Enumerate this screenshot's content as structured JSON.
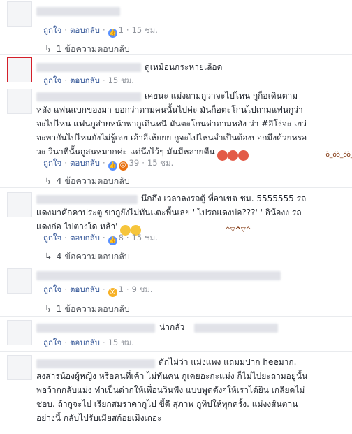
{
  "labels": {
    "like": "ถูกใจ",
    "reply": "ตอบกลับ",
    "dot": "·"
  },
  "comments": [
    {
      "count": "1",
      "time": "15 ชม.",
      "reply_summary": "1 ข้อความตอบกลับ"
    },
    {
      "text": "ดูเหมือนกระหายเลือด",
      "time": "15 ชม."
    },
    {
      "text": "เคยนะ แม่งถามกูว่าจะไปไหน กูก็อเดินตามหลัง แฟนแบกของมา บอกว่าตามคนนั้นไปค่ะ มันก็อตะโกนไปถามแฟนกูว่า จะไปไหน แฟนกูส่ายหน้าพากูเดินหนี มันตะโกนด่าตามหลัง ว่า #อีโง่จะ เยว่จะพากันไปไหนยังไม่รู้เลย เอ้าอีเห้ยยย กูจะไปไหนจำเป็นต้องบอกมึงด้วยหรอวะ วินาทีนั้นกูสนหมากค่ะ แต่นึงไว้ๆ มันมีหลายตีน",
      "count": "39",
      "time": "15 ชม.",
      "reply_summary": "4 ข้อความตอบกลับ"
    },
    {
      "text": "นึกถึง เวลาลงรถตู้ ที่อาเขต ชม. 5555555 รถแดงมาคักคาประตู ขากูยังไม่ทันแตะพื้นเลย ' ไปรถแดงบ่อ???' ' อิน้องง รถแดงก่อ ไปตางใด หล้า'",
      "count": "8",
      "time": "15 ชม.",
      "reply_summary": "4 ข้อความตอบกลับ"
    },
    {
      "count": "1",
      "time": "9 ชม."
    },
    {
      "reply_summary": "1 ข้อความตอบกลับ"
    },
    {
      "text": "น่ากลัว",
      "time": "15 ชม."
    },
    {
      "text": "ตักไม่ว่า แม่งแพง แถมมปาก heeมาก. สงสารน้องผู้หญิง หรือคนที่เค้า ไม่ทันคน กูเคยอะกะแม่ง ก็ไม่ไปยะถามอยู่นั้น พอว้ากกลับแม่ง ทำเป็นด่ากให้เพื่อนวินฟัง แบบพูดดังๆให้เราได้ยิน เกลียดไม่ชอบ. ถ้ากูจะไป เรียกสมราคากูไป ขี้ดี สุภาพ กูทิปให้ทุกครั้ง. แม่งงส้นตานอย่างนี้ กลับไปรับเมียสก้อยเมิงเถอะ"
    }
  ]
}
